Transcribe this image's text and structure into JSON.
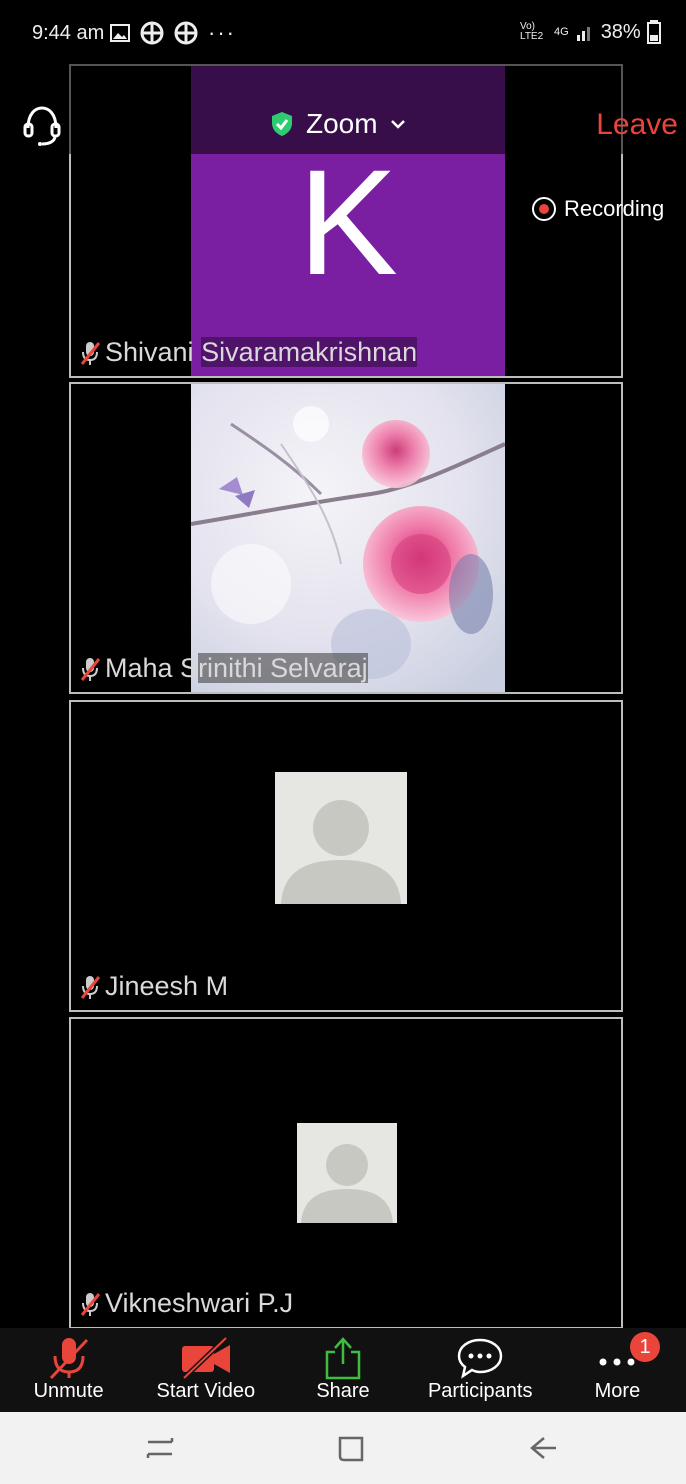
{
  "status_bar": {
    "time": "9:44 am",
    "right_text": "38%",
    "network_label_1": "Vo) LTE2",
    "network_label_2": "4G"
  },
  "toolbar_top": {
    "title": "Zoom",
    "leave_label": "Leave",
    "recording_label": "Recording",
    "shield_color": "#2ecc71"
  },
  "participants": [
    {
      "name_part1": "Shivani ",
      "name_part2": "Sivaramakrishnan",
      "avatar_letter": "K",
      "avatar_color": "#7a1fa2"
    },
    {
      "name_part1": "Maha S",
      "name_part2": "rinithi Selvaraj"
    },
    {
      "name": "Jineesh M"
    },
    {
      "name": "Vikneshwari P.J"
    }
  ],
  "bottom_toolbar": {
    "unmute": "Unmute",
    "start_video": "Start Video",
    "share": "Share",
    "participants": "Participants",
    "more": "More",
    "more_badge": "1"
  }
}
